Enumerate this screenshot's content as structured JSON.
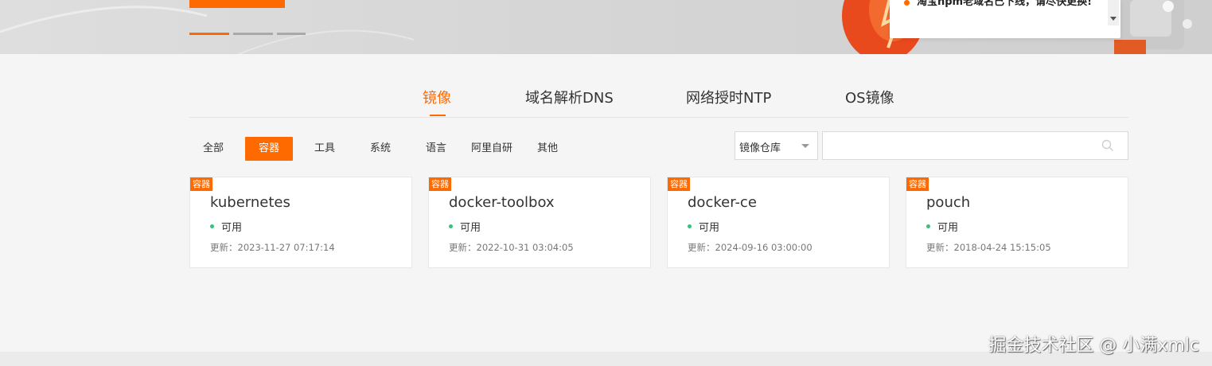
{
  "colors": {
    "accent": "#ff6a00",
    "status_ok": "#3dbd7d"
  },
  "notice": {
    "text": "淘宝npm老域名已下线，请尽快更换!"
  },
  "tabs": [
    {
      "label": "镜像",
      "active": true
    },
    {
      "label": "域名解析DNS",
      "active": false
    },
    {
      "label": "网络授时NTP",
      "active": false
    },
    {
      "label": "OS镜像",
      "active": false
    }
  ],
  "filters": [
    {
      "label": "全部",
      "active": false
    },
    {
      "label": "容器",
      "active": true
    },
    {
      "label": "工具",
      "active": false
    },
    {
      "label": "系统",
      "active": false
    },
    {
      "label": "语言",
      "active": false
    },
    {
      "label": "阿里自研",
      "active": false
    },
    {
      "label": "其他",
      "active": false
    }
  ],
  "search": {
    "select_value": "镜像仓库",
    "placeholder": "",
    "icon": "search-icon"
  },
  "cards": [
    {
      "tag": "容器",
      "title": "kubernetes",
      "status": "可用",
      "updated": "更新：2023-11-27 07:17:14"
    },
    {
      "tag": "容器",
      "title": "docker-toolbox",
      "status": "可用",
      "updated": "更新：2022-10-31 03:04:05"
    },
    {
      "tag": "容器",
      "title": "docker-ce",
      "status": "可用",
      "updated": "更新：2024-09-16 03:00:00"
    },
    {
      "tag": "容器",
      "title": "pouch",
      "status": "可用",
      "updated": "更新：2018-04-24 15:15:05"
    }
  ],
  "watermark": "掘金技术社区 @ 小满xmlc"
}
